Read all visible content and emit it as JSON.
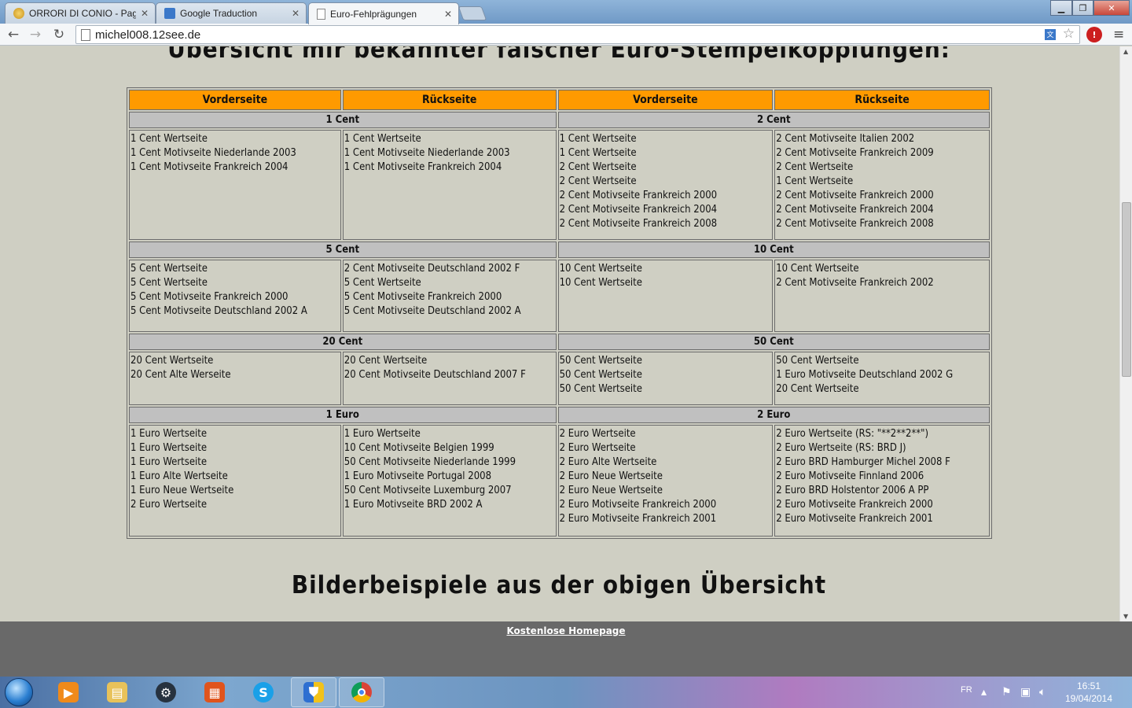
{
  "browser": {
    "tabs": [
      {
        "label": "ORRORI DI CONIO - Pagin",
        "active": false,
        "icon": "coin-icon"
      },
      {
        "label": "Google Traduction",
        "active": false,
        "icon": "google-translate-icon"
      },
      {
        "label": "Euro-Fehlprägungen",
        "active": true,
        "icon": "page-icon"
      }
    ],
    "url": "michel008.12see.de"
  },
  "page": {
    "heading_top": "Übersicht mir bekannter falscher Euro-Stempelkopplungen:",
    "heading_bottom": "Bilderbeispiele aus der obigen Übersicht",
    "footer_link": "Kostenlose Homepage"
  },
  "table": {
    "headers": [
      "Vorderseite",
      "Rückseite",
      "Vorderseite",
      "Rückseite"
    ],
    "rows": [
      {
        "left_group": "1 Cent",
        "right_group": "2 Cent",
        "cells": [
          [
            "1 Cent Wertseite",
            "1 Cent Motivseite Niederlande 2003",
            "1 Cent Motivseite Frankreich 2004"
          ],
          [
            "1 Cent Wertseite",
            "1 Cent Motivseite Niederlande 2003",
            "1 Cent Motivseite Frankreich 2004"
          ],
          [
            "1 Cent Wertseite",
            "1 Cent Wertseite",
            "2 Cent Wertseite",
            "2 Cent Wertseite",
            "2 Cent Motivseite Frankreich 2000",
            "2 Cent Motivseite Frankreich 2004",
            "2 Cent Motivseite Frankreich 2008"
          ],
          [
            "2 Cent Motivseite Italien 2002",
            "2 Cent Motivseite Frankreich 2009",
            "2 Cent Wertseite",
            "1 Cent Wertseite",
            "2 Cent Motivseite Frankreich 2000",
            "2 Cent Motivseite Frankreich 2004",
            "2 Cent Motivseite Frankreich 2008"
          ]
        ]
      },
      {
        "left_group": "5 Cent",
        "right_group": "10 Cent",
        "cells": [
          [
            "5 Cent Wertseite",
            "5 Cent Wertseite",
            "5 Cent Motivseite Frankreich 2000",
            "5 Cent Motivseite Deutschland 2002 A"
          ],
          [
            "2 Cent Motivseite Deutschland 2002 F",
            "5 Cent Wertseite",
            "5 Cent Motivseite Frankreich 2000",
            "5 Cent Motivseite Deutschland 2002 A"
          ],
          [
            "10 Cent Wertseite",
            "10 Cent Wertseite"
          ],
          [
            "10 Cent Wertseite",
            "2 Cent Motivseite Frankreich 2002"
          ]
        ]
      },
      {
        "left_group": "20 Cent",
        "right_group": "50 Cent",
        "cells": [
          [
            "20 Cent Wertseite",
            "20 Cent Alte Werseite"
          ],
          [
            "20 Cent Wertseite",
            "20 Cent Motivseite Deutschland 2007 F"
          ],
          [
            "50 Cent Wertseite",
            "50 Cent Wertseite",
            "50 Cent Wertseite"
          ],
          [
            "50 Cent Wertseite",
            "1 Euro Motivseite Deutschland 2002 G",
            "20 Cent Wertseite"
          ]
        ]
      },
      {
        "left_group": "1 Euro",
        "right_group": "2 Euro",
        "cells": [
          [
            "1 Euro Wertseite",
            "1 Euro Wertseite",
            "1 Euro Wertseite",
            "1 Euro Alte Wertseite",
            "1 Euro Neue Wertseite",
            "2 Euro Wertseite"
          ],
          [
            "1 Euro Wertseite",
            "10 Cent Motivseite Belgien 1999",
            "50 Cent Motivseite Niederlande 1999",
            "1 Euro Motivseite Portugal 2008",
            "50 Cent Motivseite Luxemburg 2007",
            "1 Euro Motivseite BRD 2002 A"
          ],
          [
            "2 Euro Wertseite",
            "2 Euro Wertseite",
            "2 Euro Alte Wertseite",
            "2 Euro Neue Wertseite",
            "2 Euro Neue Wertseite",
            "2 Euro Motivseite Frankreich 2000",
            "2 Euro Motivseite Frankreich 2001"
          ],
          [
            "2 Euro Wertseite (RS: \"**2**2**\")",
            "2 Euro Wertseite (RS: BRD J)",
            "2 Euro BRD Hamburger Michel 2008 F",
            "2 Euro Motivseite Finnland 2006",
            "2 Euro BRD Holstentor 2006 A PP",
            "2 Euro Motivseite Frankreich 2000",
            "2 Euro Motivseite Frankreich 2001"
          ]
        ]
      }
    ]
  },
  "taskbar": {
    "apps": [
      "media-player-icon",
      "file-explorer-icon",
      "steam-icon",
      "office-icon",
      "skype-icon",
      "security-shield-icon",
      "chrome-icon"
    ],
    "language": "FR",
    "time": "16:51",
    "date": "19/04/2014"
  },
  "colors": {
    "header_orange": "#ff9a00",
    "group_gray": "#c0c0c0",
    "page_background": "#cfcfc3",
    "footer_gray": "#696969"
  }
}
